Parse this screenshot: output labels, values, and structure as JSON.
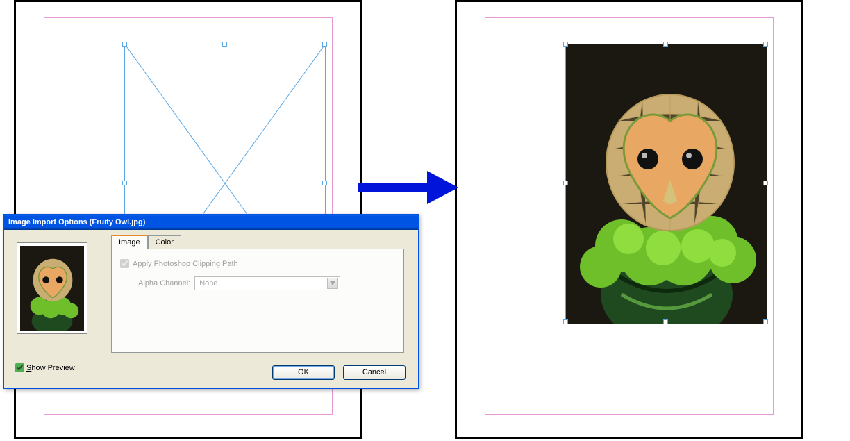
{
  "dialog": {
    "title": "Image Import Options (Fruity Owl.jpg)",
    "tabs": {
      "image": "Image",
      "color": "Color"
    },
    "apply_clipping_label_pre": "A",
    "apply_clipping_label": "pply Photoshop Clipping Path",
    "alpha_label": "Alpha Channel:",
    "alpha_value": "None",
    "show_preview_pre": "S",
    "show_preview_label": "how Preview",
    "ok": "OK",
    "cancel": "Cancel"
  }
}
